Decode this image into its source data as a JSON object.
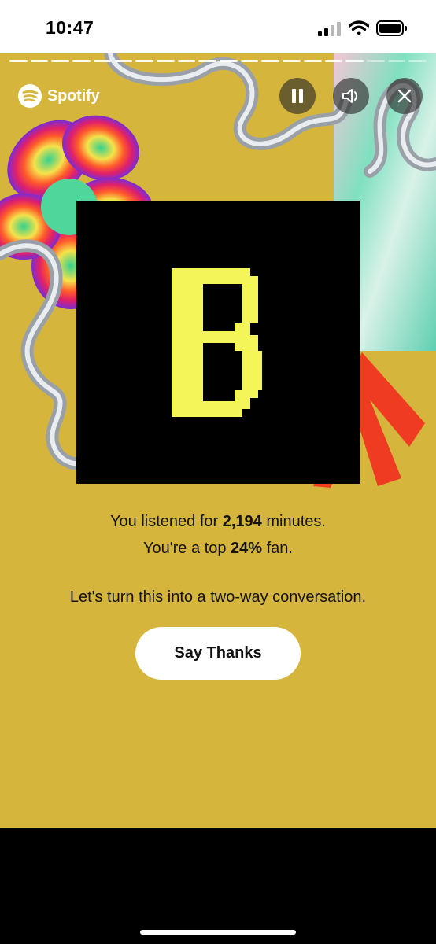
{
  "status_bar": {
    "time": "10:47",
    "icons": [
      "signal-icon",
      "wifi-icon",
      "battery-icon"
    ]
  },
  "story": {
    "brand": "Spotify",
    "progress": {
      "segments_total": 20,
      "segments_filled": 17
    },
    "controls": [
      "pause-icon",
      "volume-icon",
      "close-icon"
    ],
    "background_color": "#d5b53b",
    "album_letter": "B",
    "album_letter_color": "#f4f558",
    "stats": {
      "minutes_prefix": "You listened for ",
      "minutes_value": "2,194",
      "minutes_suffix": " minutes.",
      "fan_prefix": "You're a top ",
      "fan_value": "24%",
      "fan_suffix": " fan."
    },
    "prompt": "Let's turn this into a two-way conversation.",
    "cta_label": "Say Thanks"
  }
}
